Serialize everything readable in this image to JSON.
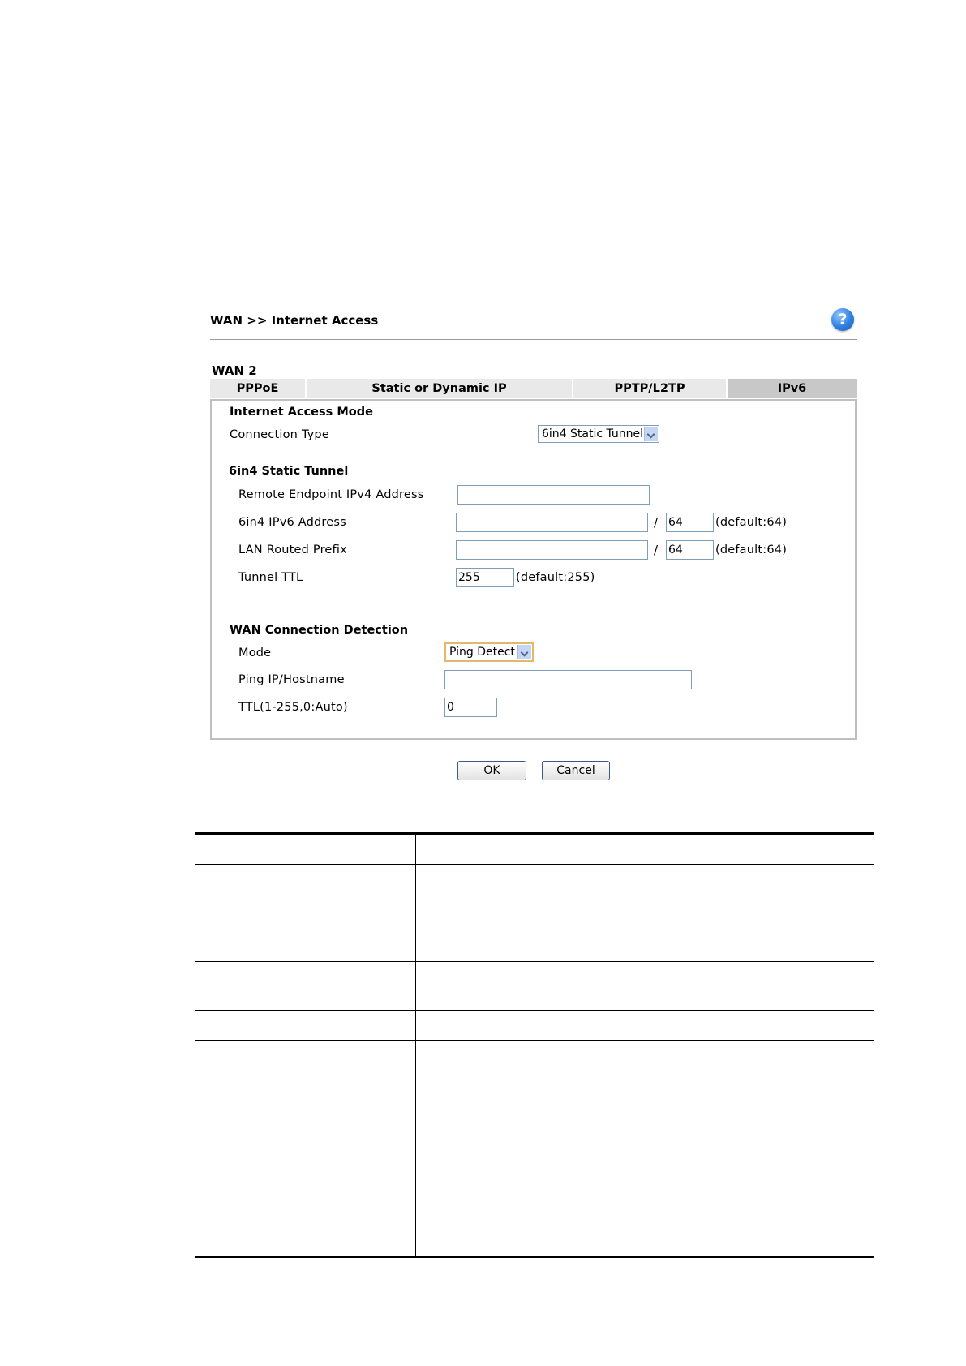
{
  "header": {
    "title": "WAN >> Internet Access",
    "help_icon": "?"
  },
  "wan_label": "WAN 2",
  "tabs": [
    {
      "label": "PPPoE",
      "active": false
    },
    {
      "label": "Static or Dynamic IP",
      "active": false
    },
    {
      "label": "PPTP/L2TP",
      "active": false
    },
    {
      "label": "IPv6",
      "active": true
    }
  ],
  "internet_access_mode": {
    "heading": "Internet Access Mode",
    "connection_type_label": "Connection Type",
    "connection_type_value": "6in4 Static Tunnel"
  },
  "static_tunnel": {
    "heading": "6in4 Static Tunnel",
    "remote_endpoint_label": "Remote Endpoint IPv4 Address",
    "remote_endpoint_value": "",
    "ipv6_address_label": "6in4 IPv6 Address",
    "ipv6_address_value": "",
    "ipv6_prefix_len": "64",
    "ipv6_prefix_default": "(default:64)",
    "lan_prefix_label": "LAN Routed Prefix",
    "lan_prefix_value": "",
    "lan_prefix_len": "64",
    "lan_prefix_default": "(default:64)",
    "tunnel_ttl_label": "Tunnel TTL",
    "tunnel_ttl_value": "255",
    "tunnel_ttl_default": "(default:255)",
    "slash": "/"
  },
  "detection": {
    "heading": "WAN Connection Detection",
    "mode_label": "Mode",
    "mode_value": "Ping Detect",
    "ping_label": "Ping IP/Hostname",
    "ping_value": "",
    "ttl_label": "TTL(1-255,0:Auto)",
    "ttl_value": "0"
  },
  "buttons": {
    "ok": "OK",
    "cancel": "Cancel"
  },
  "colors": {
    "tab_bg": "#e9e9e9",
    "tab_active_bg": "#c8c8c8",
    "input_border": "#7f9db9",
    "help_blue": "#2f7fe0"
  }
}
